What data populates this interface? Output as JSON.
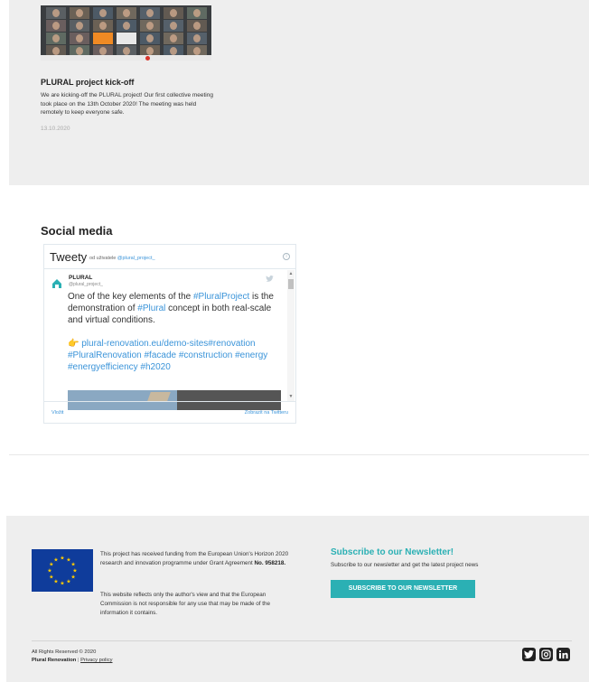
{
  "news": {
    "title": "PLURAL project kick-off",
    "text": "We are kicking-off the PLURAL project! Our first collective meeting took place on the 13th October 2020! The meeting was held remotely to keep everyone safe.",
    "date": "13.10.2020"
  },
  "social": {
    "heading": "Social media",
    "widget": {
      "title": "Tweety",
      "from_prefix": "od uživatele",
      "from_handle": "@plural_project_",
      "info_icon": "info-icon",
      "tweet": {
        "name": "PLURAL",
        "handle": "@plural_project_",
        "text_part1": "One of the key elements of the ",
        "hashtag1": "#PluralProject",
        "text_part2": " is the demonstration of ",
        "hashtag2": "#Plural",
        "text_part3": " concept in both real-scale and virtual conditions.",
        "pointer": "👉",
        "links": " plural-renovation.eu/demo-sites#renovation #PluralRenovation #facade #construction #energy #energyefficiency #h2020"
      },
      "embed_label": "Vložit",
      "view_label": "Zobrazit na Twitteru"
    }
  },
  "footer": {
    "funding_text_a": "This project has received funding from the European Union's Horizon 2020 research and innovation programme under Grant Agreement ",
    "funding_text_b": "No. 958218.",
    "disclaimer": "This website reflects only the author's view and that the European Commission is not responsible for any use that may be made of the information it contains.",
    "subscribe_title": "Subscribe to our Newsletter!",
    "subscribe_text": "Subscribe to our newsletter and get the latest project news",
    "subscribe_button": "SUBSCRIBE TO OUR NEWSLETTER",
    "rights": "All Rights Reserved © 2020",
    "brand": "Plural Renovation",
    "separator": "|",
    "privacy": "Privacy policy",
    "social_icons": [
      "twitter-icon",
      "instagram-icon",
      "linkedin-icon"
    ]
  },
  "colors": {
    "accent": "#2bb0b4",
    "eu_blue": "#0f3c9b",
    "eu_star": "#ffcc00",
    "twitter_link": "#3b94d9",
    "panel_bg": "#eeeeee"
  }
}
